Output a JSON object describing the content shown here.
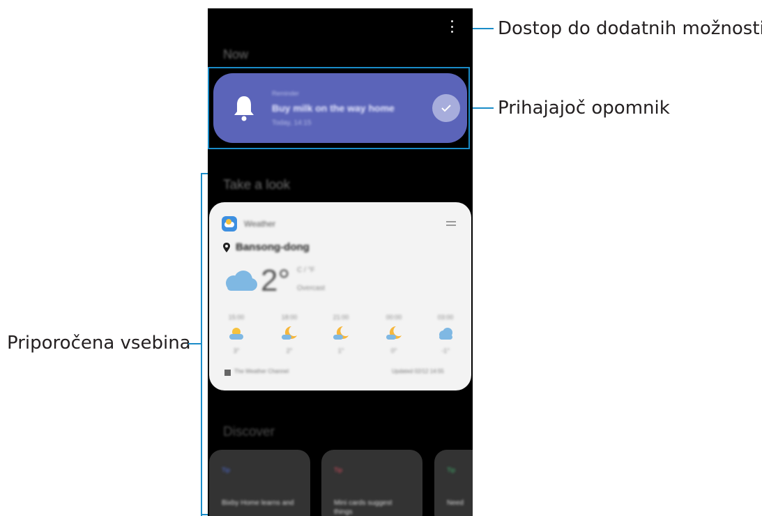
{
  "annotations": {
    "more_options": "Dostop do dodatnih možnosti.",
    "upcoming_reminder": "Prihajajoč opomnik",
    "recommended_content": "Priporočena vsebina"
  },
  "phone": {
    "section_now": "Now",
    "reminder": {
      "label": "Reminder",
      "title": "Buy milk on the way home",
      "time": "Today, 14:15"
    },
    "section_take_a_look": "Take a look",
    "weather": {
      "app_name": "Weather",
      "location": "Bansong-dong",
      "temperature": "2°",
      "unit": "C / °F",
      "condition": "Overcast",
      "hourly": [
        {
          "time": "15:00",
          "icon": "sun-cloud-icon",
          "temp": "3°"
        },
        {
          "time": "18:00",
          "icon": "moon-cloud-icon",
          "temp": "2°"
        },
        {
          "time": "21:00",
          "icon": "moon-cloud-icon",
          "temp": "1°"
        },
        {
          "time": "00:00",
          "icon": "moon-cloud-icon",
          "temp": "0°"
        },
        {
          "time": "03:00",
          "icon": "cloud-icon",
          "temp": "-1°"
        }
      ],
      "source": "The Weather Channel",
      "updated": "Updated 02/12 14:55"
    },
    "section_discover": "Discover",
    "discover": [
      {
        "tip": "Tip",
        "text": "Bixby Home learns and",
        "tip_color": "#4d6bd6"
      },
      {
        "tip": "Tip",
        "text": "Mini cards suggest things",
        "tip_color": "#d64d5e"
      },
      {
        "tip": "Tip",
        "text": "Need",
        "tip_color": "#3fae6a"
      }
    ]
  },
  "colors": {
    "accent_line": "#1a8cc8",
    "reminder_card": "#5b64b9",
    "weather_card": "#f3f3f3"
  }
}
